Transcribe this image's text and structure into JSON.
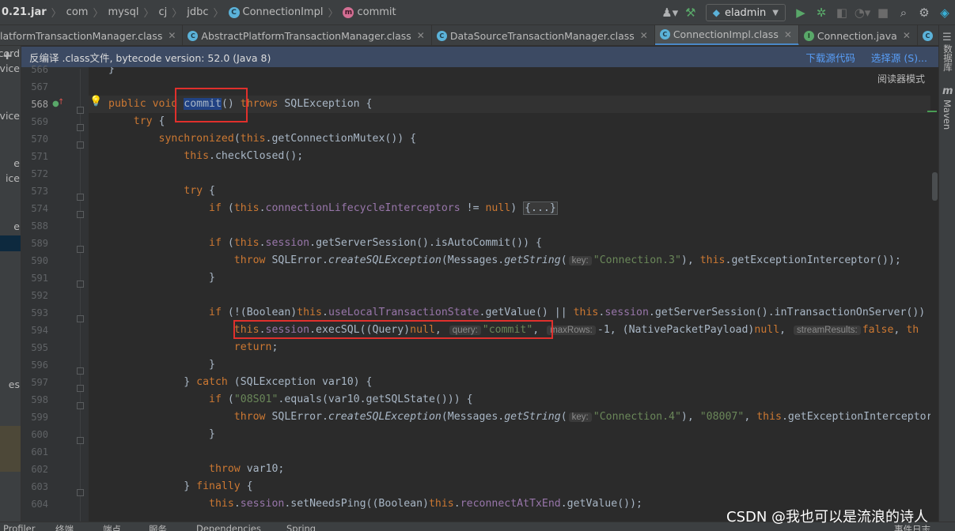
{
  "breadcrumbs": [
    "0.21.jar",
    "com",
    "mysql",
    "cj",
    "jdbc",
    "ConnectionImpl",
    "commit"
  ],
  "run_config": {
    "label": "eladmin"
  },
  "tabs": [
    {
      "label": "latformTransactionManager.class",
      "active": false
    },
    {
      "label": "AbstractPlatformTransactionManager.class",
      "active": false
    },
    {
      "label": "DataSourceTransactionManager.class",
      "active": false
    },
    {
      "label": "ConnectionImpl.class",
      "active": true
    },
    {
      "label": "Connection.java",
      "active": false
    },
    {
      "label": "",
      "active": false
    }
  ],
  "banner": {
    "text": "反编译 .class文件, bytecode version: 52.0 (Java 8)",
    "download_source": "下载源代码",
    "choose_source": "选择源 (S)..."
  },
  "reader_mode": "阅读器模式",
  "left_panel_fragments": [
    "cord",
    "rvice",
    "rvice",
    "e",
    "ice",
    "e",
    "es"
  ],
  "right_panel": {
    "database": "数据库",
    "maven": "Maven"
  },
  "code": {
    "line_numbers": [
      "566",
      "567",
      "568",
      "569",
      "570",
      "571",
      "572",
      "573",
      "574",
      "588",
      "589",
      "590",
      "591",
      "592",
      "593",
      "594",
      "595",
      "596",
      "597",
      "598",
      "599",
      "600",
      "601",
      "602",
      "603",
      "604"
    ],
    "current_line": "568"
  },
  "hints": {
    "key": "key:",
    "query": "query:",
    "max_rows": "maxRows:",
    "stream_results": "streamResults:"
  },
  "bottom_bar": [
    "Profiler",
    "终端",
    "端点",
    "服务",
    "Dependencies",
    "Spring",
    "事件日志"
  ],
  "watermark": "CSDN @我也可以是流浪的诗人"
}
